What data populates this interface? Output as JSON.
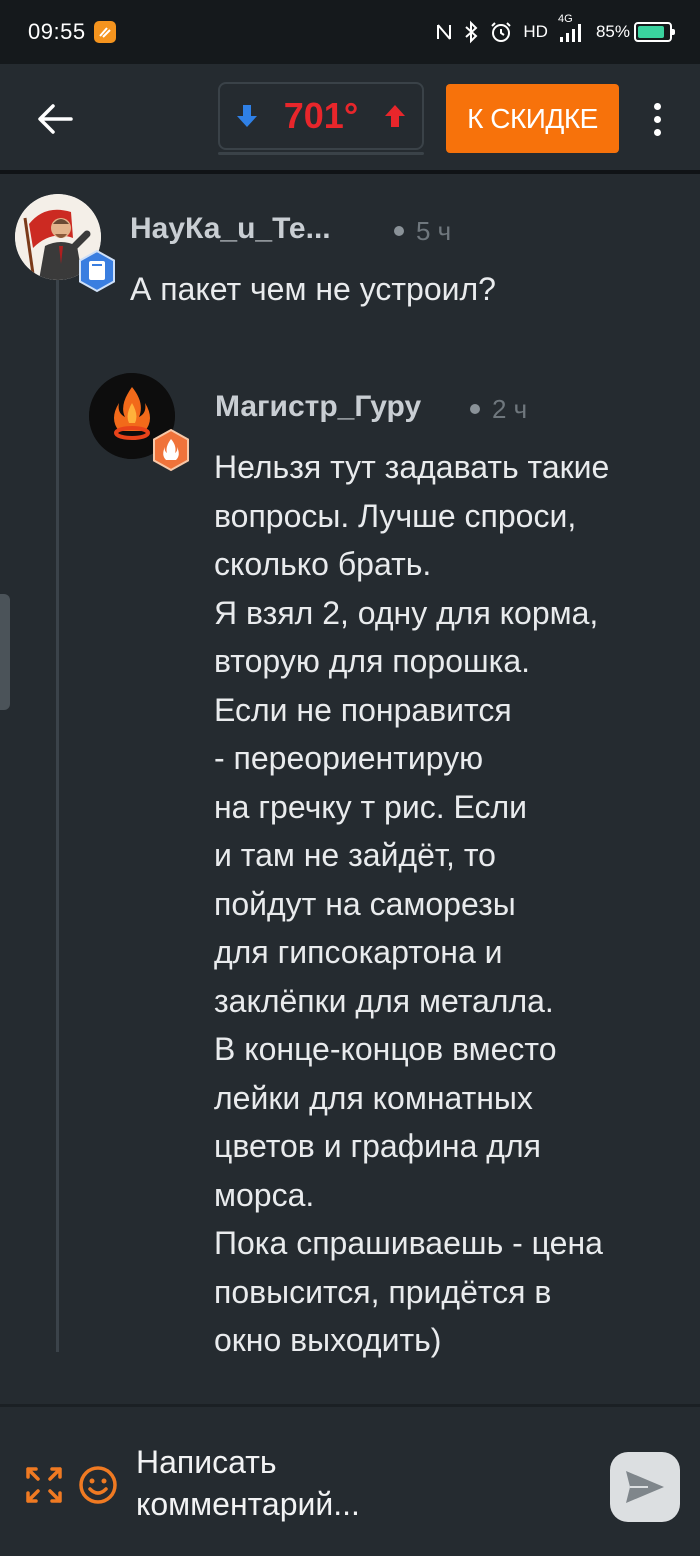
{
  "status_bar": {
    "time": "09:55",
    "network_label": "HD",
    "signal_label": "4G",
    "battery_percent": "85%",
    "battery_level": 0.85,
    "icons": [
      "nfc-icon",
      "bluetooth-icon",
      "alarm-icon",
      "signal-icon",
      "battery-icon"
    ]
  },
  "app_bar": {
    "rating": "701°",
    "deal_button_label": "К СКИДКЕ",
    "colors": {
      "rating": "#e8262b",
      "vote_down": "#2f80e6",
      "vote_up": "#e8262b",
      "deal_button": "#f7720b"
    }
  },
  "comments": {
    "parent": {
      "username": "НауКа_u_Те...",
      "time": "5 ч",
      "text": "А пакет чем не устроил?",
      "badge": "book-badge-icon"
    },
    "reply": {
      "username": "Магистр_Гуру",
      "time": "2 ч",
      "text": "Нельзя тут задавать такие\nвопросы. Лучше спроси,\nсколько брать.\nЯ взял 2, одну для корма,\nвторую для порошка.\nЕсли не понравится\n- переориентирую\nна гречку т рис. Если\nи там не зайдёт, то\nпойдут на саморезы\nдля гипсокартона и\nзаклёпки для металла.\nВ конце-концов вместо\nлейки для комнатных\nцветов и графина для\nморса.\nПока спрашиваешь - цена\nповысится, придётся в\nокно выходить)",
      "badge": "flame-badge-icon"
    }
  },
  "composer": {
    "placeholder": "Написать\nкомментарий..."
  }
}
